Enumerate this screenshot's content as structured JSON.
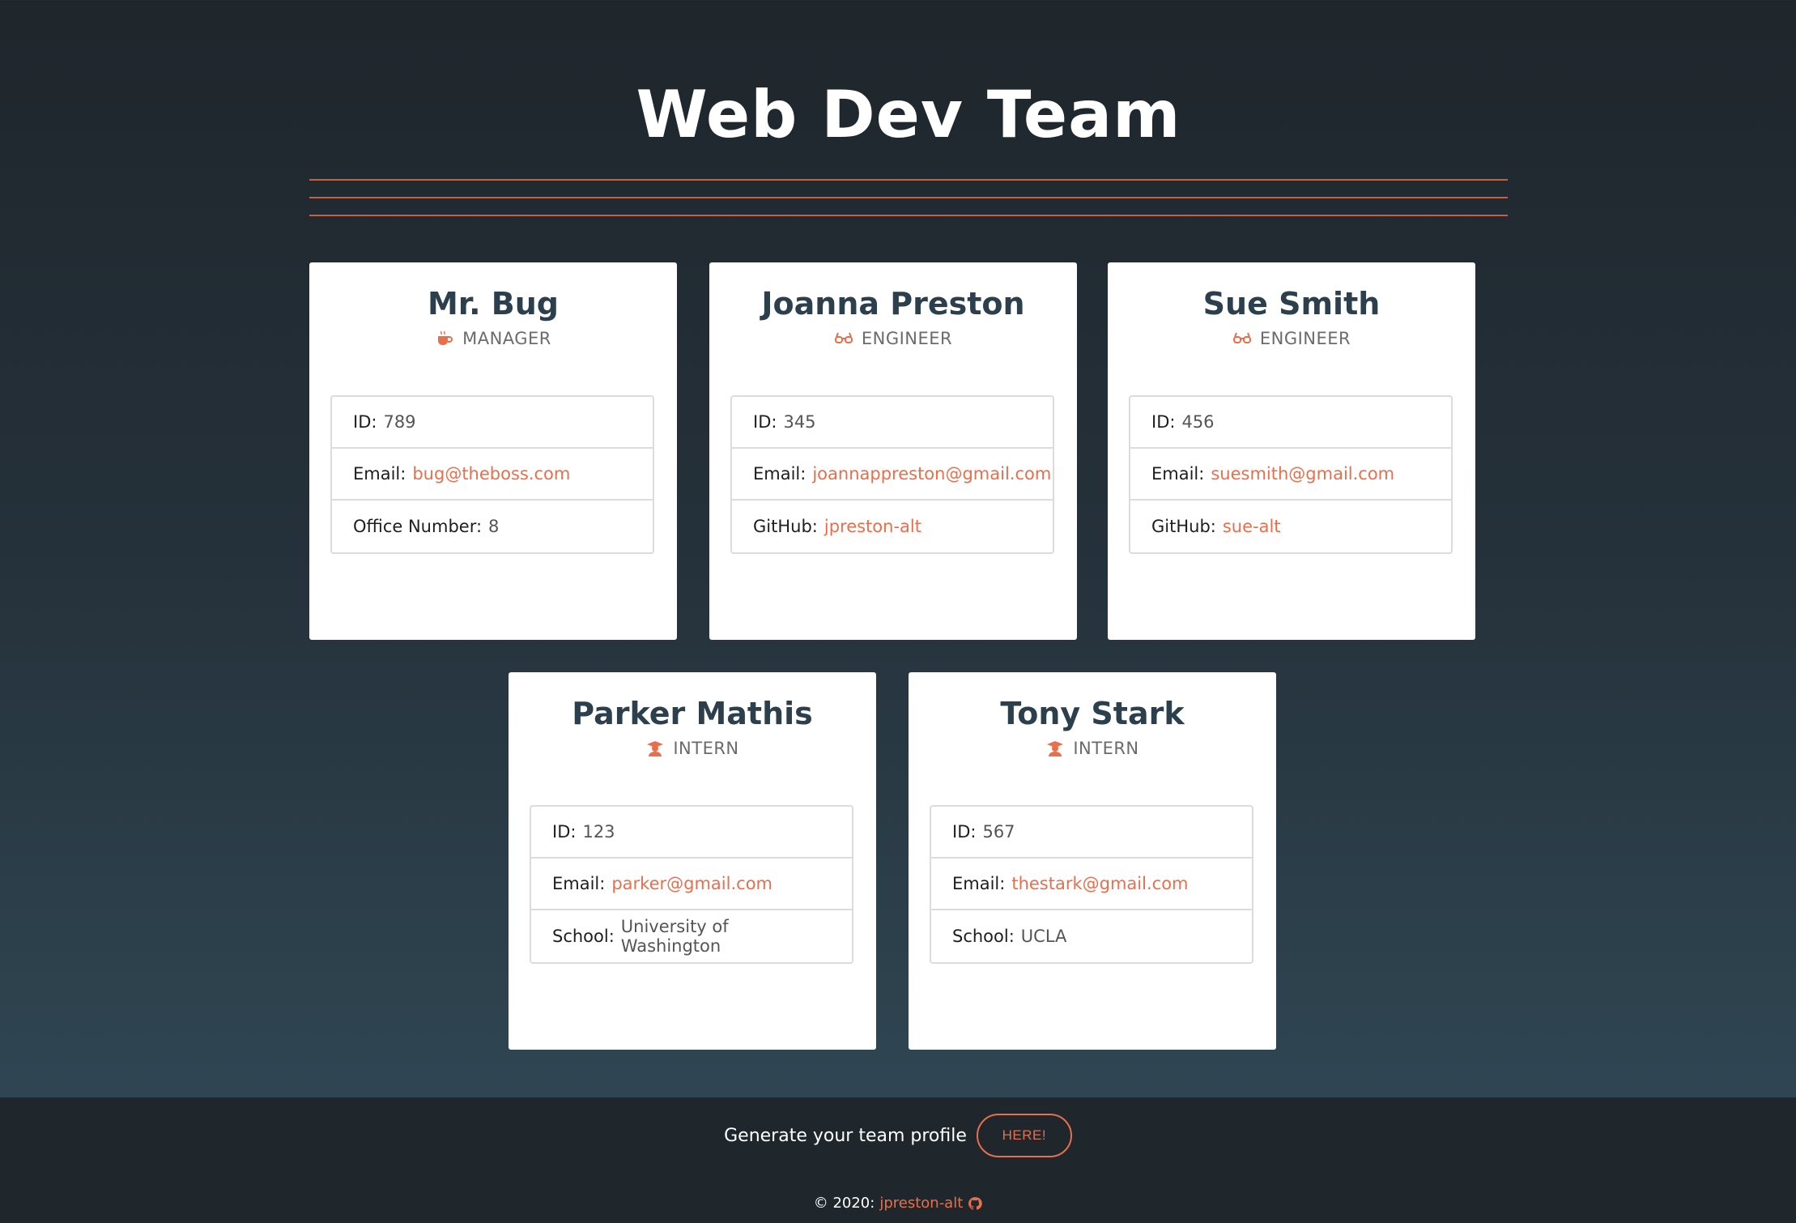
{
  "page": {
    "title": "Web Dev Team"
  },
  "colors": {
    "accent": "#e86f4c",
    "name": "#2b3f4d",
    "background": "#25313a",
    "footer": "#1f272d"
  },
  "members": [
    {
      "name": "Mr. Bug",
      "role": "MANAGER",
      "role_icon": "coffee-icon",
      "id_label": "ID:",
      "id": "789",
      "email_label": "Email:",
      "email": "bug@theboss.com",
      "extra_label": "Office Number:",
      "extra": "8"
    },
    {
      "name": "Joanna Preston",
      "role": "ENGINEER",
      "role_icon": "glasses-icon",
      "id_label": "ID:",
      "id": "345",
      "email_label": "Email:",
      "email": "joannappreston@gmail.com",
      "extra_label": "GitHub:",
      "extra": "jpreston-alt"
    },
    {
      "name": "Sue Smith",
      "role": "ENGINEER",
      "role_icon": "glasses-icon",
      "id_label": "ID:",
      "id": "456",
      "email_label": "Email:",
      "email": "suesmith@gmail.com",
      "extra_label": "GitHub:",
      "extra": "sue-alt"
    },
    {
      "name": "Parker Mathis",
      "role": "INTERN",
      "role_icon": "graduate-icon",
      "id_label": "ID:",
      "id": "123",
      "email_label": "Email:",
      "email": "parker@gmail.com",
      "extra_label": "School:",
      "extra": "University of Washington"
    },
    {
      "name": "Tony Stark",
      "role": "INTERN",
      "role_icon": "graduate-icon",
      "id_label": "ID:",
      "id": "567",
      "email_label": "Email:",
      "email": "thestark@gmail.com",
      "extra_label": "School:",
      "extra": "UCLA"
    }
  ],
  "footer": {
    "prompt": "Generate your team profile",
    "button_label": "HERE!",
    "copyright": "© 2020:",
    "author": "jpreston-alt",
    "author_icon": "github-icon"
  }
}
